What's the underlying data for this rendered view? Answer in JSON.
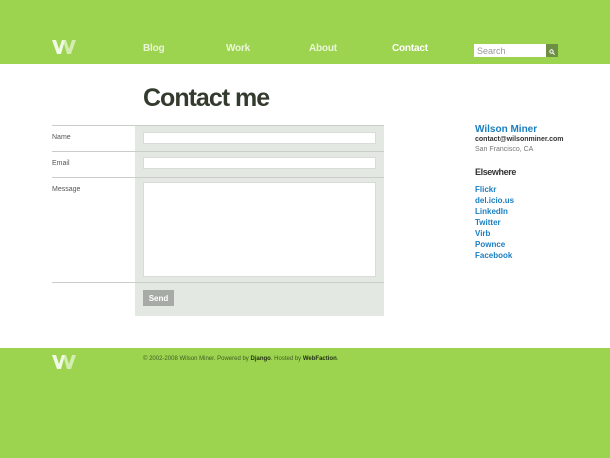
{
  "header": {
    "nav": [
      {
        "label": "Blog",
        "active": false
      },
      {
        "label": "Work",
        "active": false
      },
      {
        "label": "About",
        "active": false
      },
      {
        "label": "Contact",
        "active": true
      }
    ],
    "search": {
      "placeholder": "Search",
      "value": ""
    },
    "icons": {
      "logo": "wm-logo-icon",
      "search": "search-icon"
    }
  },
  "page": {
    "title": "Contact me"
  },
  "form": {
    "name_label": "Name",
    "email_label": "Email",
    "message_label": "Message",
    "name_value": "",
    "email_value": "",
    "message_value": "",
    "send_label": "Send"
  },
  "sidebar": {
    "name": "Wilson Miner",
    "email": "contact@wilsonminer.com",
    "location": "San Francisco, CA",
    "elsewhere_heading": "Elsewhere",
    "links": [
      "Flickr",
      "del.icio.us",
      "LinkedIn",
      "Twitter",
      "Virb",
      "Pownce",
      "Facebook"
    ]
  },
  "footer": {
    "copyright": "© 2002-2008 Wilson Miner. Powered by",
    "django": "Django",
    "hosted": ". Hosted by",
    "webfaction": "WebFaction",
    "end": "."
  },
  "colors": {
    "brand_green": "#9dd44f",
    "link_blue": "#1a7fc1",
    "form_panel": "#e3e8e2",
    "button_gray": "#a6aba5"
  }
}
